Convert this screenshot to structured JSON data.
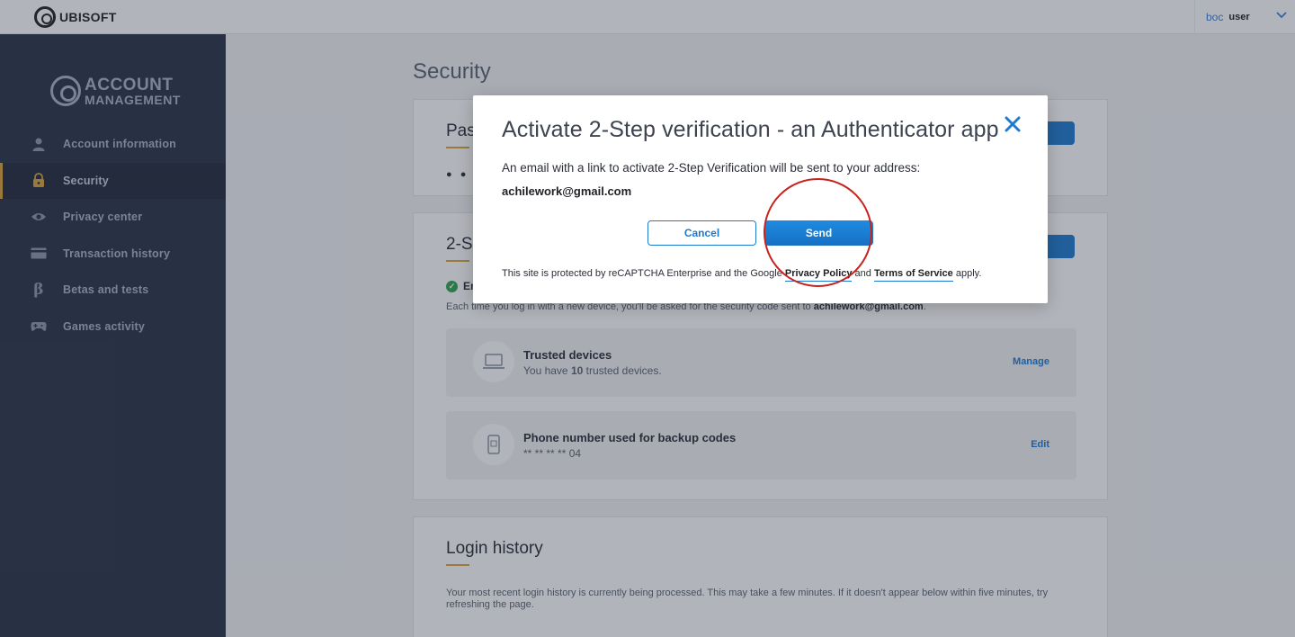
{
  "topbar": {
    "brand": "UBISOFT",
    "user_initial": "boc",
    "user_name": "user",
    "menu_icon": "chevron-down-icon"
  },
  "sidebar": {
    "logo_line1": "ACCOUNT",
    "logo_line2": "MANAGEMENT",
    "items": [
      {
        "label": "Account information",
        "icon": "user-icon"
      },
      {
        "label": "Security",
        "icon": "lock-icon",
        "active": true
      },
      {
        "label": "Privacy center",
        "icon": "eye-icon"
      },
      {
        "label": "Transaction history",
        "icon": "card-icon"
      },
      {
        "label": "Betas and tests",
        "icon": "beta-icon"
      },
      {
        "label": "Games activity",
        "icon": "gamepad-icon"
      }
    ]
  },
  "main": {
    "page_title": "Security",
    "password_card": {
      "title": "Pas",
      "masked": "● ● ●"
    },
    "twostep_card": {
      "title": "2-S",
      "status": "Em",
      "info_prefix": "Each time you log in with a new device, you'll be asked for the security code sent to ",
      "info_email": "achilework@gmail.com",
      "info_suffix": "."
    },
    "trusted_devices": {
      "title": "Trusted devices",
      "text_prefix": "You have ",
      "count": "10",
      "text_suffix": " trusted devices.",
      "link": "Manage"
    },
    "backup_phone": {
      "title": "Phone number used for backup codes",
      "masked_number": "** ** ** ** 04",
      "link": "Edit"
    },
    "login_history": {
      "title": "Login history",
      "note": "Your most recent login history is currently being processed. This may take a few minutes. If it doesn't appear below within five minutes, try refreshing the page."
    }
  },
  "modal": {
    "title": "Activate 2-Step verification - an Authenticator app",
    "description": "An email with a link to activate 2-Step Verification will be sent to your address:",
    "email": "achilework@gmail.com",
    "cancel_label": "Cancel",
    "send_label": "Send",
    "recaptcha_prefix": "This site is protected by reCAPTCHA Enterprise and the Google ",
    "privacy_policy": "Privacy Policy",
    "recaptcha_and": " and ",
    "terms_of_service": "Terms of Service",
    "recaptcha_suffix": " apply."
  },
  "colors": {
    "accent": "#1e7ad0",
    "sidebar_bg": "#2a3246",
    "active_marker": "#d9a43a",
    "highlight": "#c8221e"
  }
}
